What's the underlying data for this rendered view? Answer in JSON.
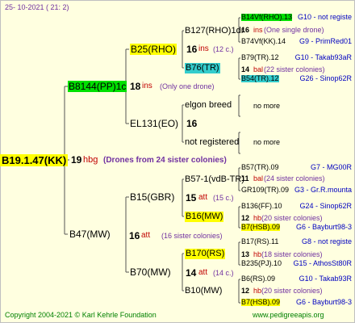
{
  "header": {
    "date": "25- 10-2021 ( 21: 2)"
  },
  "root": {
    "name": "B19.1.47(KK)",
    "num": "19",
    "type": "hbg",
    "note": "(Drones from 24 sister colonies)"
  },
  "gen1": {
    "upper": {
      "name": "B8144(PP)1c",
      "num": "18",
      "type": "ins",
      "note": "(Only one drone)"
    },
    "lower": {
      "name": "B47(MW)",
      "num": "16",
      "type": "att",
      "note": "(16 sister colonies)"
    }
  },
  "gen2": {
    "a": {
      "name": "B25(RHO)",
      "num": "16",
      "type": "ins",
      "note": "(12 c.)"
    },
    "b": {
      "name": "EL131(EO)",
      "num": "16"
    },
    "c": {
      "name": "B15(GBR)",
      "num": "15",
      "type": "att",
      "note": "(15 c.)"
    },
    "d": {
      "name": "B70(MW)",
      "num": "14",
      "type": "att",
      "note": "(14 c.)"
    }
  },
  "gen3": {
    "a1": "B127(RHO)1dr",
    "a2": "B76(TR)",
    "b1": "elgon breed",
    "b2": "not registered",
    "c1": "B57-1(vdB-TR)",
    "c2": "B16(MW)",
    "d1": "B170(RS)",
    "d2": "B10(MW)"
  },
  "gen4": [
    {
      "name": "B14Vf(RHO).13",
      "loc": "G10 - not registe"
    },
    {
      "num": "16",
      "type": "ins",
      "note": "(One single drone)"
    },
    {
      "name": "B74Vf(KK).14",
      "loc": "G9 - PrimRed01"
    },
    {
      "name": "B79(TR).12",
      "loc": "G10 - Takab93aR"
    },
    {
      "num": "14",
      "type": "bal",
      "note": "(22 sister colonies)"
    },
    {
      "name": "B54(TR).12",
      "loc": "G26 - Sinop62R"
    },
    {
      "more": "no more"
    },
    {
      "more": "no more"
    },
    {
      "name": "B57(TR).09",
      "loc": "G7 - MG00R"
    },
    {
      "num": "11",
      "type": "bal",
      "note": "(24 sister colonies)"
    },
    {
      "name": "GR109(TR).09",
      "loc": "G3 - Gr.R.mounta"
    },
    {
      "name": "B136(FF).10",
      "loc": "G24 - Sinop62R"
    },
    {
      "num": "12",
      "type": "hb",
      "note": "(20 sister colonies)"
    },
    {
      "name": "B7(HSB).09",
      "loc": "G6 - Bayburt98-3"
    },
    {
      "name": "B17(RS).11",
      "loc": "G8 - not registe"
    },
    {
      "num": "13",
      "type": "hb",
      "note": "(18 sister colonies)"
    },
    {
      "name": "B235(PJ).10",
      "loc": "G15 - AthosSt80R"
    },
    {
      "name": "B6(RS).09",
      "loc": "G10 - Takab93R"
    },
    {
      "num": "12",
      "type": "hb",
      "note": "(20 sister colonies)"
    },
    {
      "name": "B7(HSB).09",
      "loc": "G6 - Bayburt98-3"
    }
  ],
  "footer": {
    "copyright": "Copyright 2004-2021 © Karl Kehrle Foundation",
    "site": "www.pedigreeapis.org"
  },
  "colors": {
    "yellow": "#ffff00",
    "green": "#00e000",
    "cyan": "#33cccc",
    "red": "#c00000",
    "footer": "#008000"
  }
}
